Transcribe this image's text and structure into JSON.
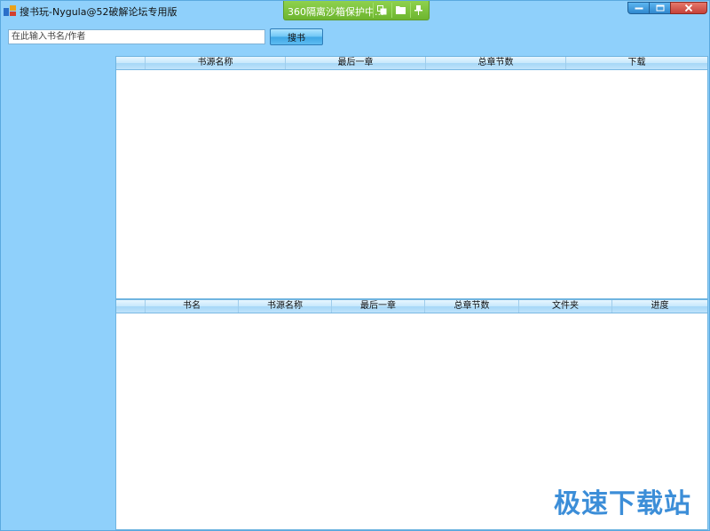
{
  "window": {
    "title": "搜书玩-Nygula@52破解论坛专用版"
  },
  "sandbox": {
    "text": "360隔离沙箱保护中..."
  },
  "search": {
    "placeholder": "在此输入书名/作者",
    "value": "",
    "button_label": "搜书"
  },
  "results_grid": {
    "columns": [
      "书源名称",
      "最后一章",
      "总章节数",
      "下载"
    ],
    "rows": []
  },
  "downloads_grid": {
    "columns": [
      "书名",
      "书源名称",
      "最后一章",
      "总章节数",
      "文件夹",
      "进度"
    ],
    "rows": []
  },
  "watermark": {
    "text": "极速下载站"
  },
  "colors": {
    "window_bg": "#8fd0fb",
    "sandbox_bar": "#6db52f",
    "close_button": "#c6423a",
    "watermark": "#3c8ed8"
  },
  "icons": [
    "app-icon",
    "sandbox-window-icon",
    "folder-icon",
    "pin-icon",
    "minimize-icon",
    "maximize-icon",
    "close-icon"
  ]
}
